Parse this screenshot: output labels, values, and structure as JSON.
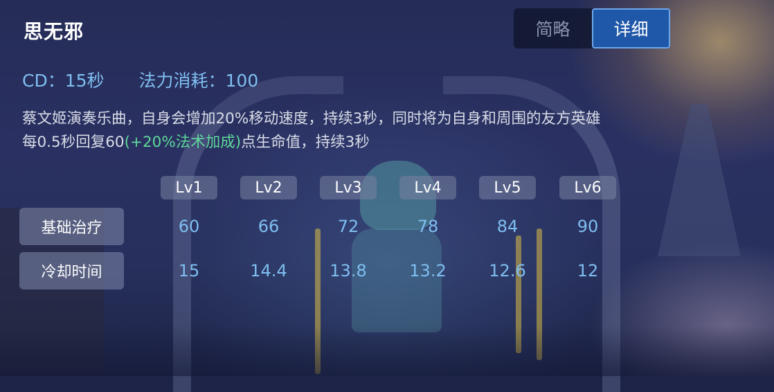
{
  "skill": {
    "name": "思无邪",
    "cd_text": "CD：15秒",
    "mana_text": "法力消耗：100"
  },
  "view_toggle": {
    "options": [
      "简略",
      "详细"
    ],
    "selected": "详细"
  },
  "description": {
    "line1": "蔡文姬演奏乐曲，自身会增加20%移动速度，持续3秒，同时将为自身和周围的友方英雄",
    "line2_before": "每0.5秒回复60",
    "line2_bonus": "(+20%法术加成)",
    "line2_after": "点生命值，持续3秒"
  },
  "levels": [
    "Lv1",
    "Lv2",
    "Lv3",
    "Lv4",
    "Lv5",
    "Lv6"
  ],
  "rows": [
    {
      "label": "基础治疗",
      "values": [
        "60",
        "66",
        "72",
        "78",
        "84",
        "90"
      ]
    },
    {
      "label": "冷却时间",
      "values": [
        "15",
        "14.4",
        "13.8",
        "13.2",
        "12.6",
        "12"
      ]
    }
  ],
  "colors": {
    "accent_blue": "#7fbff0",
    "bonus_green": "#5fd99a",
    "active_tab": "#1f58a8"
  }
}
